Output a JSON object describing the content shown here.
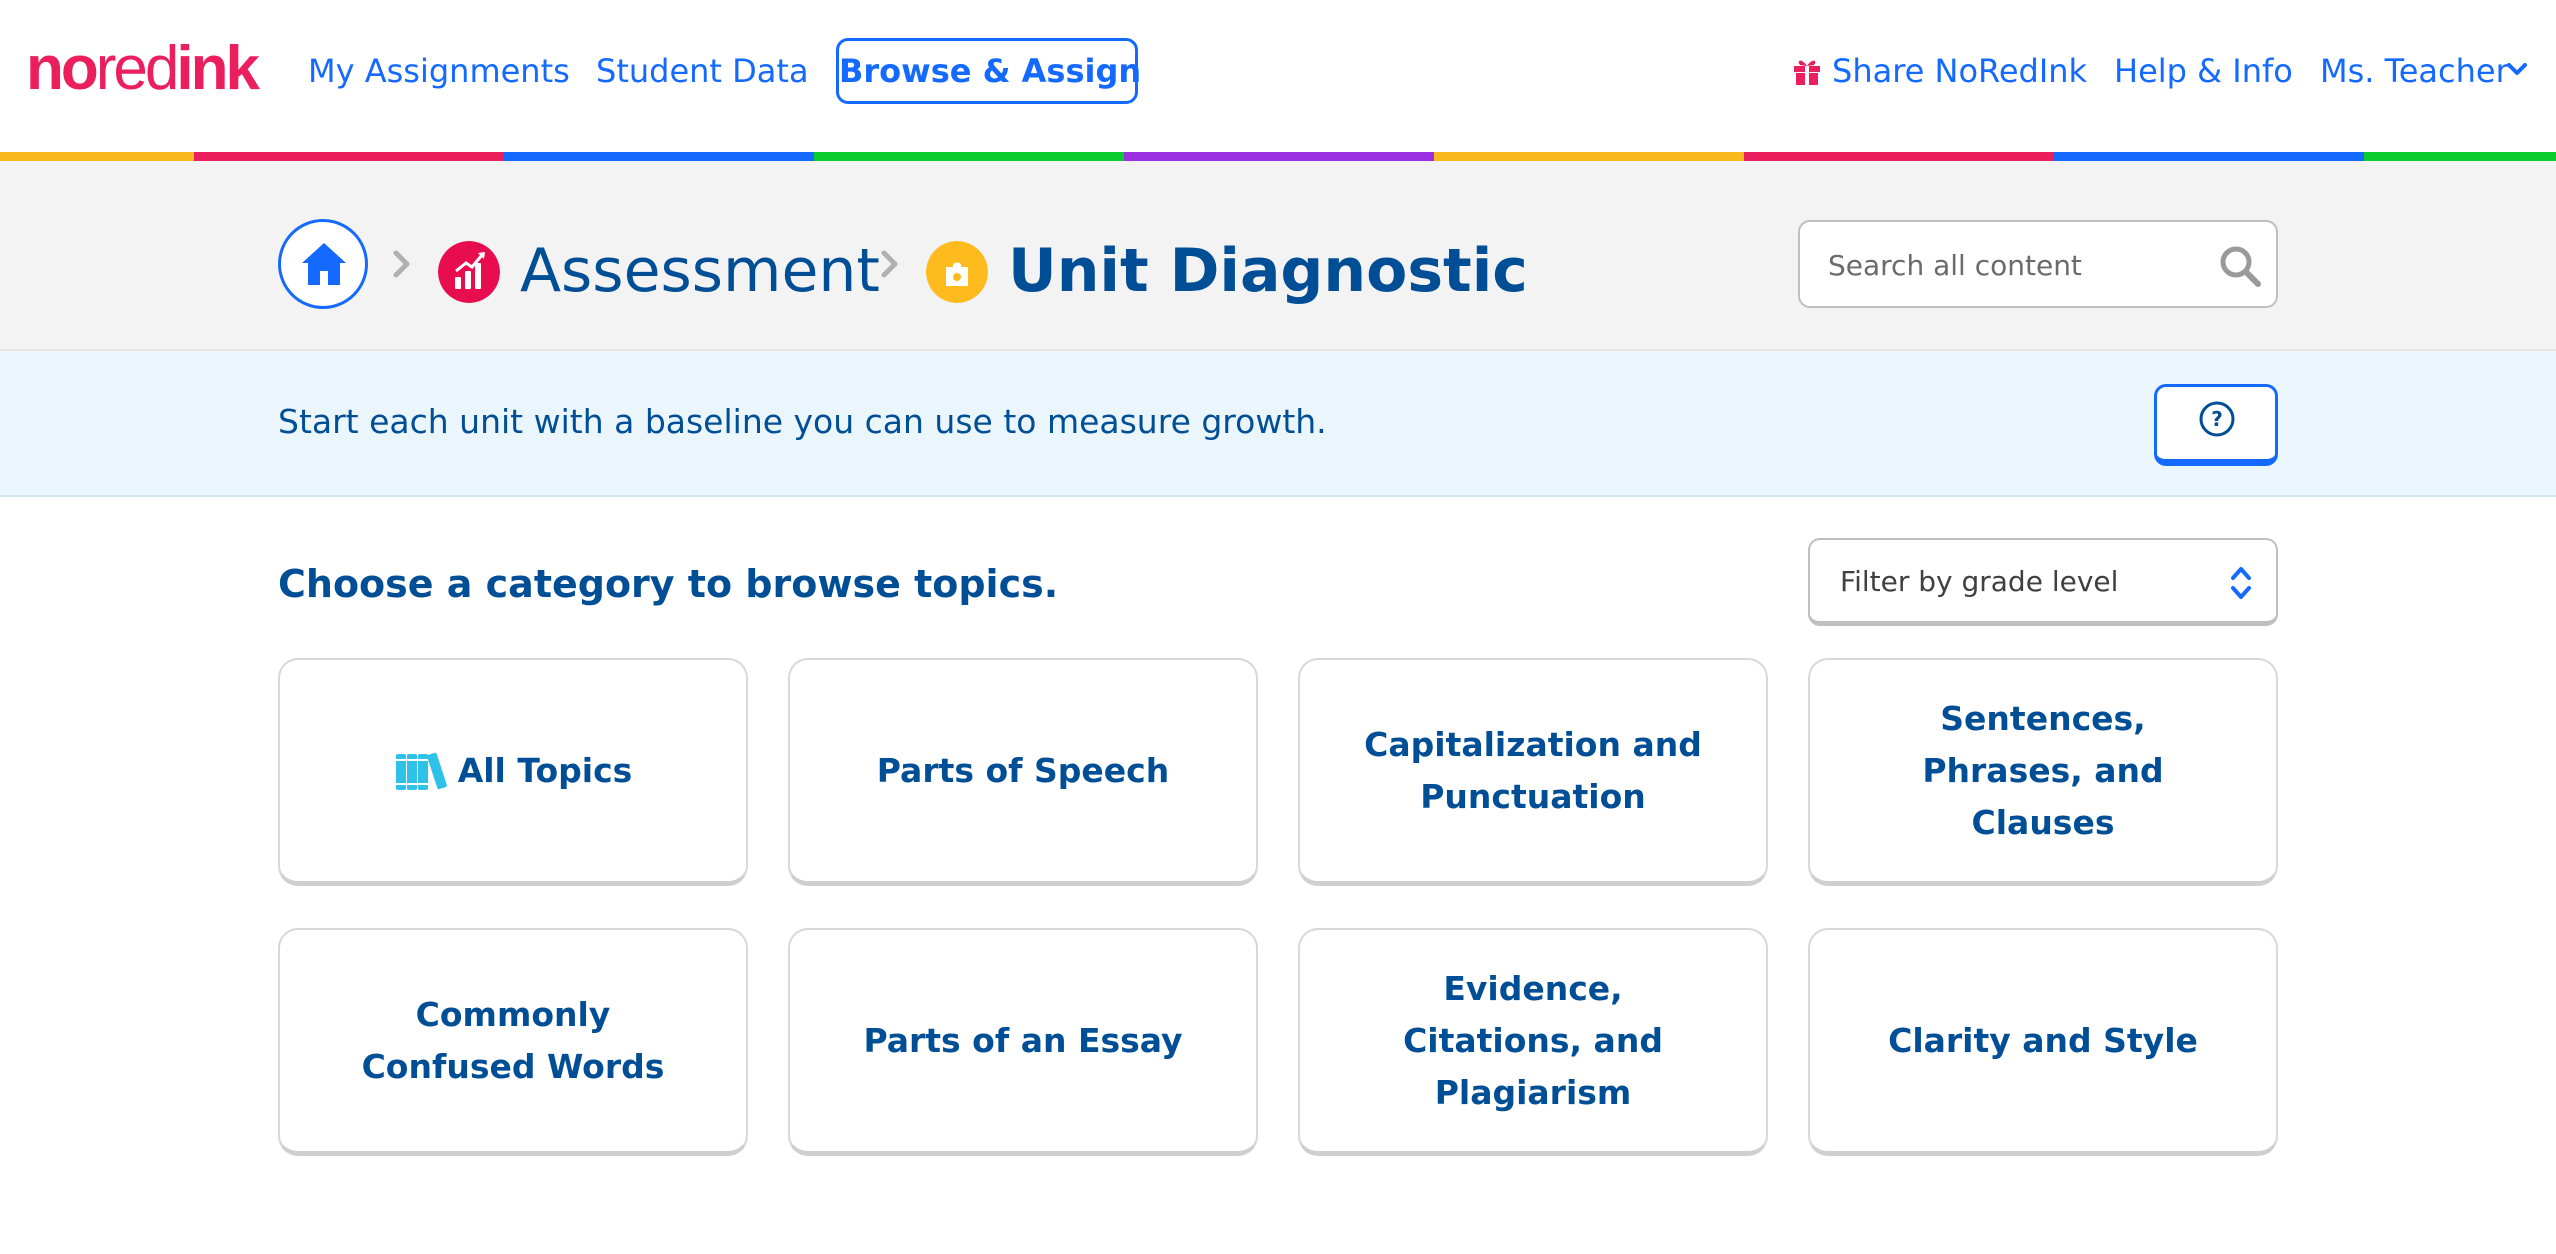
{
  "logo": {
    "part1": "no",
    "part2": "red",
    "part3": "ink"
  },
  "nav": {
    "my_assignments": "My Assignments",
    "student_data": "Student Data",
    "browse_assign": "Browse & Assign",
    "share": "Share NoRedInk",
    "help": "Help & Info",
    "user": "Ms. Teacher",
    "share_icon": "gift-icon",
    "user_menu_icon": "chevron-down-icon"
  },
  "rainbow_colors": [
    "#f9b81c",
    "#eb1e5e",
    "#146aff",
    "#0acd2d",
    "#9b30e2",
    "#f9b81c",
    "#eb1e5e",
    "#146aff",
    "#0acd2d"
  ],
  "breadcrumb": {
    "home_icon": "home-icon",
    "level1": "Assessment",
    "level1_icon": "chart-icon",
    "level1_color": "#e70d4f",
    "level2": "Unit Diagnostic",
    "level2_icon": "puzzle-icon",
    "level2_color": "#febb1e"
  },
  "search": {
    "placeholder": "Search all content",
    "icon": "search-icon"
  },
  "banner": {
    "text": "Start each unit with a baseline you can use to measure growth.",
    "help_icon": "question-icon"
  },
  "main": {
    "title": "Choose a category to browse topics.",
    "filter_label": "Filter by grade level",
    "filter_icon": "up-down-icon"
  },
  "categories": [
    {
      "label": "All Topics",
      "icon": "books-icon"
    },
    {
      "label": "Parts of Speech"
    },
    {
      "label": "Capitalization and Punctuation"
    },
    {
      "label": "Sentences, Phrases, and Clauses"
    },
    {
      "label": "Commonly Confused Words"
    },
    {
      "label": "Parts of an Essay"
    },
    {
      "label": "Evidence, Citations, and Plagiarism"
    },
    {
      "label": "Clarity and Style"
    }
  ],
  "colors": {
    "primary": "#146aff",
    "navy": "#004e95",
    "brand": "#eb1e5e"
  }
}
